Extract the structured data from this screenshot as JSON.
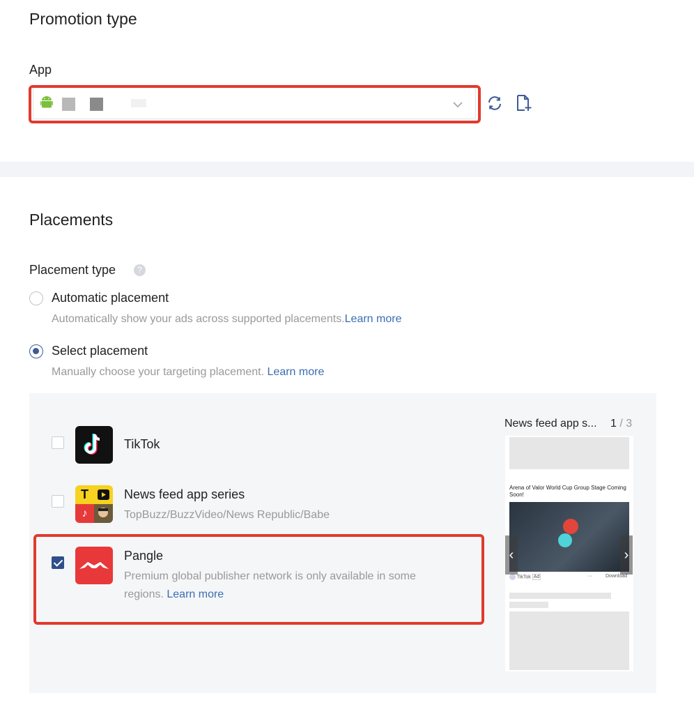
{
  "promotion": {
    "title": "Promotion type",
    "app_label": "App"
  },
  "icons": {
    "android": "android-icon",
    "refresh": "refresh-icon",
    "add_file": "file-add-icon",
    "chevron": "chevron-down-icon",
    "help": "help-icon"
  },
  "placements": {
    "title": "Placements",
    "type_label": "Placement type",
    "automatic": {
      "label": "Automatic placement",
      "desc": "Automatically show your ads across supported placements.",
      "link": "Learn more"
    },
    "select": {
      "label": "Select placement",
      "desc": "Manually choose your targeting placement. ",
      "link": "Learn more"
    },
    "items": [
      {
        "name": "TikTok",
        "desc": "",
        "checked": false
      },
      {
        "name": "News feed app series",
        "desc": "TopBuzz/BuzzVideo/News Republic/Babe",
        "checked": false
      },
      {
        "name": "Pangle",
        "desc": "Premium global publisher network is only available in some regions.  ",
        "link": "Learn more",
        "checked": true
      }
    ]
  },
  "preview": {
    "title": "News feed app s...",
    "current": "1",
    "separator": " / ",
    "total": "3",
    "headline": "Arena of Valor World Cup Group Stage Coming Soon!",
    "source": "TikTok",
    "ad_tag": "Ad",
    "more": "···",
    "cta": "Download"
  },
  "colors": {
    "accent": "#3d5a99",
    "highlight": "#e03a2e",
    "tiktok_bg": "#111111",
    "pangle_bg": "#e8383a",
    "newsfeed_bg": "#f7d21e"
  }
}
